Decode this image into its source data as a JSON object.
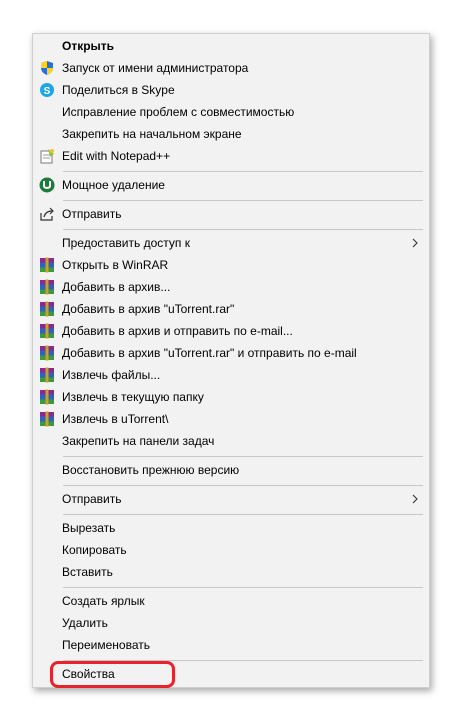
{
  "menu": {
    "items": [
      {
        "label": "Открыть",
        "bold": true,
        "icon": ""
      },
      {
        "label": "Запуск от имени администратора",
        "icon": "uac-shield-icon"
      },
      {
        "label": "Поделиться в Skype",
        "icon": "skype-icon"
      },
      {
        "label": "Исправление проблем с совместимостью",
        "icon": ""
      },
      {
        "label": "Закрепить на начальном экране",
        "icon": ""
      },
      {
        "label": "Edit with Notepad++",
        "icon": "notepadpp-icon"
      },
      {
        "label": "Мощное удаление",
        "icon": "uninstaller-icon"
      },
      {
        "label": "Отправить",
        "icon": "share-icon"
      },
      {
        "label": "Предоставить доступ к",
        "icon": "",
        "submenu": true
      },
      {
        "label": "Открыть в WinRAR",
        "icon": "winrar-icon"
      },
      {
        "label": "Добавить в архив...",
        "icon": "winrar-icon"
      },
      {
        "label": "Добавить в архив \"uTorrent.rar\"",
        "icon": "winrar-icon"
      },
      {
        "label": "Добавить в архив и отправить по e-mail...",
        "icon": "winrar-icon"
      },
      {
        "label": "Добавить в архив \"uTorrent.rar\" и отправить по e-mail",
        "icon": "winrar-icon"
      },
      {
        "label": "Извлечь файлы...",
        "icon": "winrar-icon"
      },
      {
        "label": "Извлечь в текущую папку",
        "icon": "winrar-icon"
      },
      {
        "label": "Извлечь в uTorrent\\",
        "icon": "winrar-icon"
      },
      {
        "label": "Закрепить на панели задач",
        "icon": ""
      },
      {
        "label": "Восстановить прежнюю версию",
        "icon": ""
      },
      {
        "label": "Отправить",
        "icon": "",
        "submenu": true
      },
      {
        "label": "Вырезать",
        "icon": ""
      },
      {
        "label": "Копировать",
        "icon": ""
      },
      {
        "label": "Вставить",
        "icon": ""
      },
      {
        "label": "Создать ярлык",
        "icon": ""
      },
      {
        "label": "Удалить",
        "icon": ""
      },
      {
        "label": "Переименовать",
        "icon": ""
      },
      {
        "label": "Свойства",
        "icon": "",
        "highlighted": true
      }
    ]
  },
  "colors": {
    "highlight": "#e8222a",
    "menu_bg": "#f2f2f2",
    "separator": "#c8c8c8"
  }
}
